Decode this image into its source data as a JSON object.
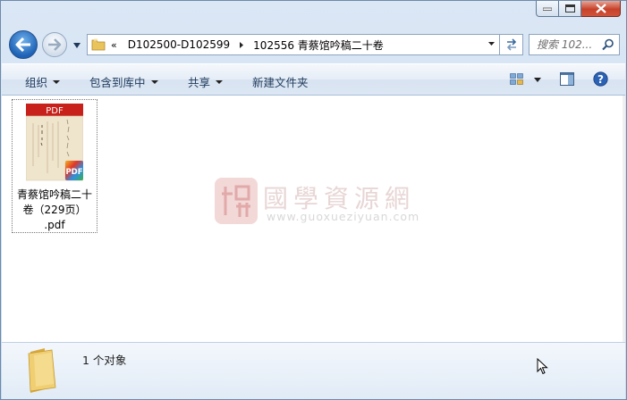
{
  "window": {
    "caption": {
      "minimize_icon": "minimize-icon",
      "maximize_icon": "maximize-icon",
      "close_icon": "close-icon"
    }
  },
  "address_bar": {
    "overflow_chevron": "«",
    "breadcrumbs": [
      "D102500-D102599",
      "102556 青蔡馆吟稿二十卷"
    ]
  },
  "search": {
    "placeholder": "搜索 102..."
  },
  "toolbar": {
    "organize": "组织",
    "include_in_library": "包含到库中",
    "share": "共享",
    "new_folder": "新建文件夹"
  },
  "files": [
    {
      "name": "青蔡馆吟稿二十卷（229页）.pdf",
      "name_lines": [
        "青蔡馆吟稿二十",
        "卷（229页）",
        ".pdf"
      ],
      "thumb_badge": "PDF",
      "type_badge": "PDF"
    }
  ],
  "watermark": {
    "text": "國學資源網",
    "url": "www.guoxueziyuan.com"
  },
  "details": {
    "count_text": "1 个对象"
  },
  "colors": {
    "accent": "#1e395b",
    "pdf_red": "#c8201a",
    "folder_yellow": "#e8c45a"
  }
}
